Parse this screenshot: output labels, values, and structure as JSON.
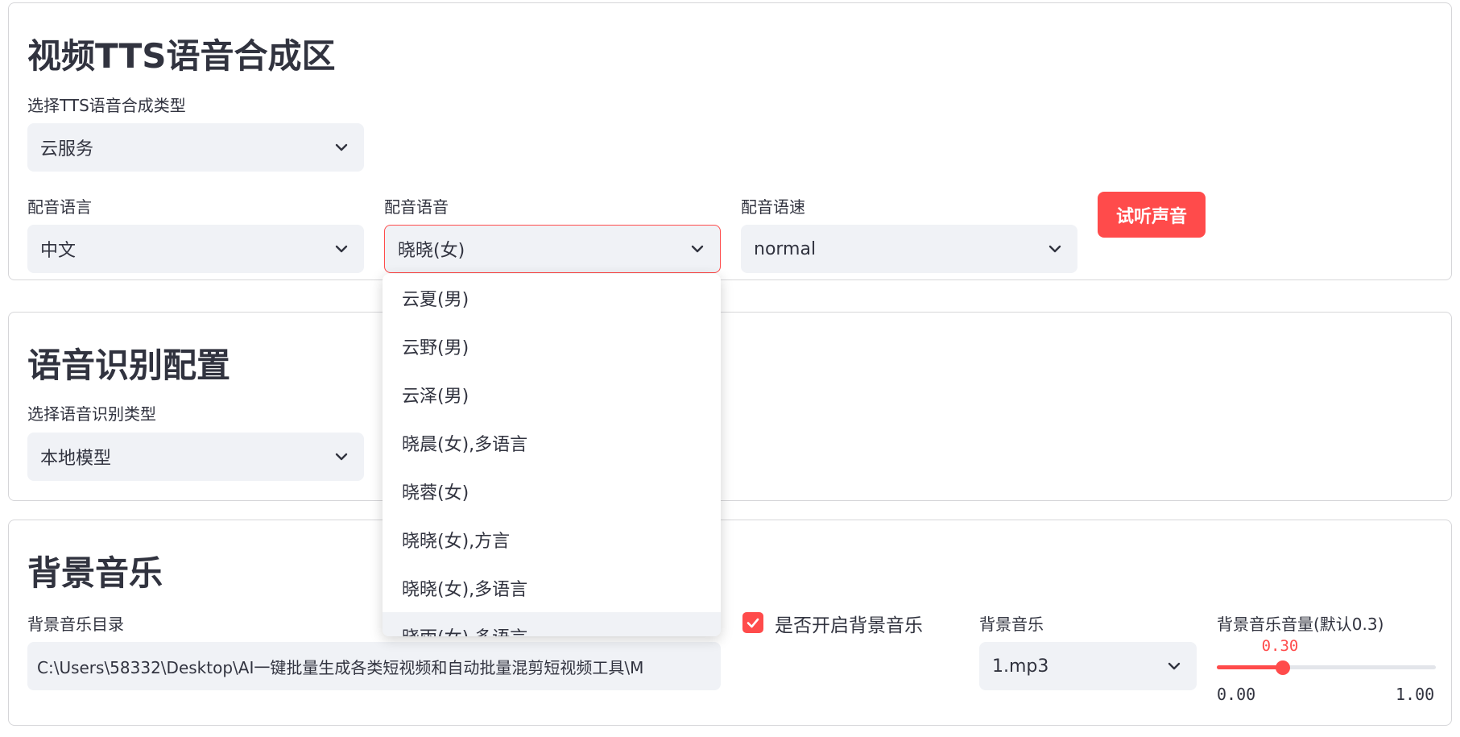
{
  "tts_section": {
    "title": "视频TTS语音合成区",
    "type_label": "选择TTS语音合成类型",
    "type_value": "云服务",
    "lang_label": "配音语言",
    "lang_value": "中文",
    "voice_label": "配音语音",
    "voice_value": "晓晓(女)",
    "speed_label": "配音语速",
    "speed_value": "normal",
    "listen_button": "试听声音"
  },
  "voice_dropdown": {
    "options": [
      "云夏(男)",
      "云野(男)",
      "云泽(男)",
      "晓晨(女),多语言",
      "晓蓉(女)",
      "晓晓(女),方言",
      "晓晓(女),多语言",
      "晓雨(女),多语言"
    ],
    "highlighted_index": 7
  },
  "asr_section": {
    "title": "语音识别配置",
    "type_label": "选择语音识别类型",
    "type_value": "本地模型"
  },
  "bgm_section": {
    "title": "背景音乐",
    "dir_label": "背景音乐目录",
    "dir_value": "C:\\Users\\58332\\Desktop\\AI一键批量生成各类短视频和自动批量混剪短视频工具\\M",
    "enable_label": "是否开启背景音乐",
    "enable_checked": true,
    "music_label": "背景音乐",
    "music_value": "1.mp3",
    "volume_label": "背景音乐音量(默认0.3)",
    "volume_value": "0.30",
    "volume_fraction": 0.3,
    "volume_min": "0.00",
    "volume_max": "1.00"
  },
  "colors": {
    "accent": "#ff4b4b",
    "input_bg": "#f0f2f6",
    "text": "#31333f",
    "border": "#d6d6d9"
  }
}
